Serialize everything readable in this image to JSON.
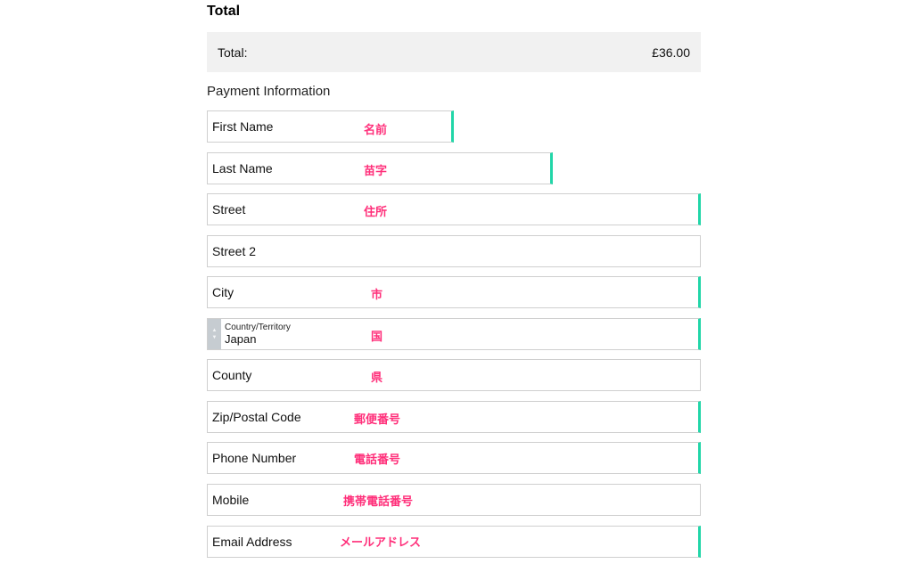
{
  "total": {
    "heading": "Total",
    "label": "Total:",
    "amount": "£36.00"
  },
  "payment": {
    "heading": "Payment Information",
    "fields": [
      {
        "label": "First Name",
        "note": "名前"
      },
      {
        "label": "Last Name",
        "note": "苗字"
      },
      {
        "label": "Street",
        "note": "住所"
      },
      {
        "label": "Street 2",
        "note": ""
      },
      {
        "label": "City",
        "note": "市"
      },
      {
        "label": "Country/Territory",
        "value": "Japan",
        "note": "国"
      },
      {
        "label": "County",
        "note": "県"
      },
      {
        "label": "Zip/Postal Code",
        "note": "郵便番号"
      },
      {
        "label": "Phone Number",
        "note": "電話番号"
      },
      {
        "label": "Mobile",
        "note": "携帯電話番号"
      },
      {
        "label": "Email Address",
        "note": "メールアドレス"
      }
    ]
  },
  "colors": {
    "accent": "#21d6a8",
    "annotation": "#ff2f7a",
    "total_bg": "#f1f1f1"
  },
  "icons": {
    "country_select": "updown-chevron-icon"
  }
}
